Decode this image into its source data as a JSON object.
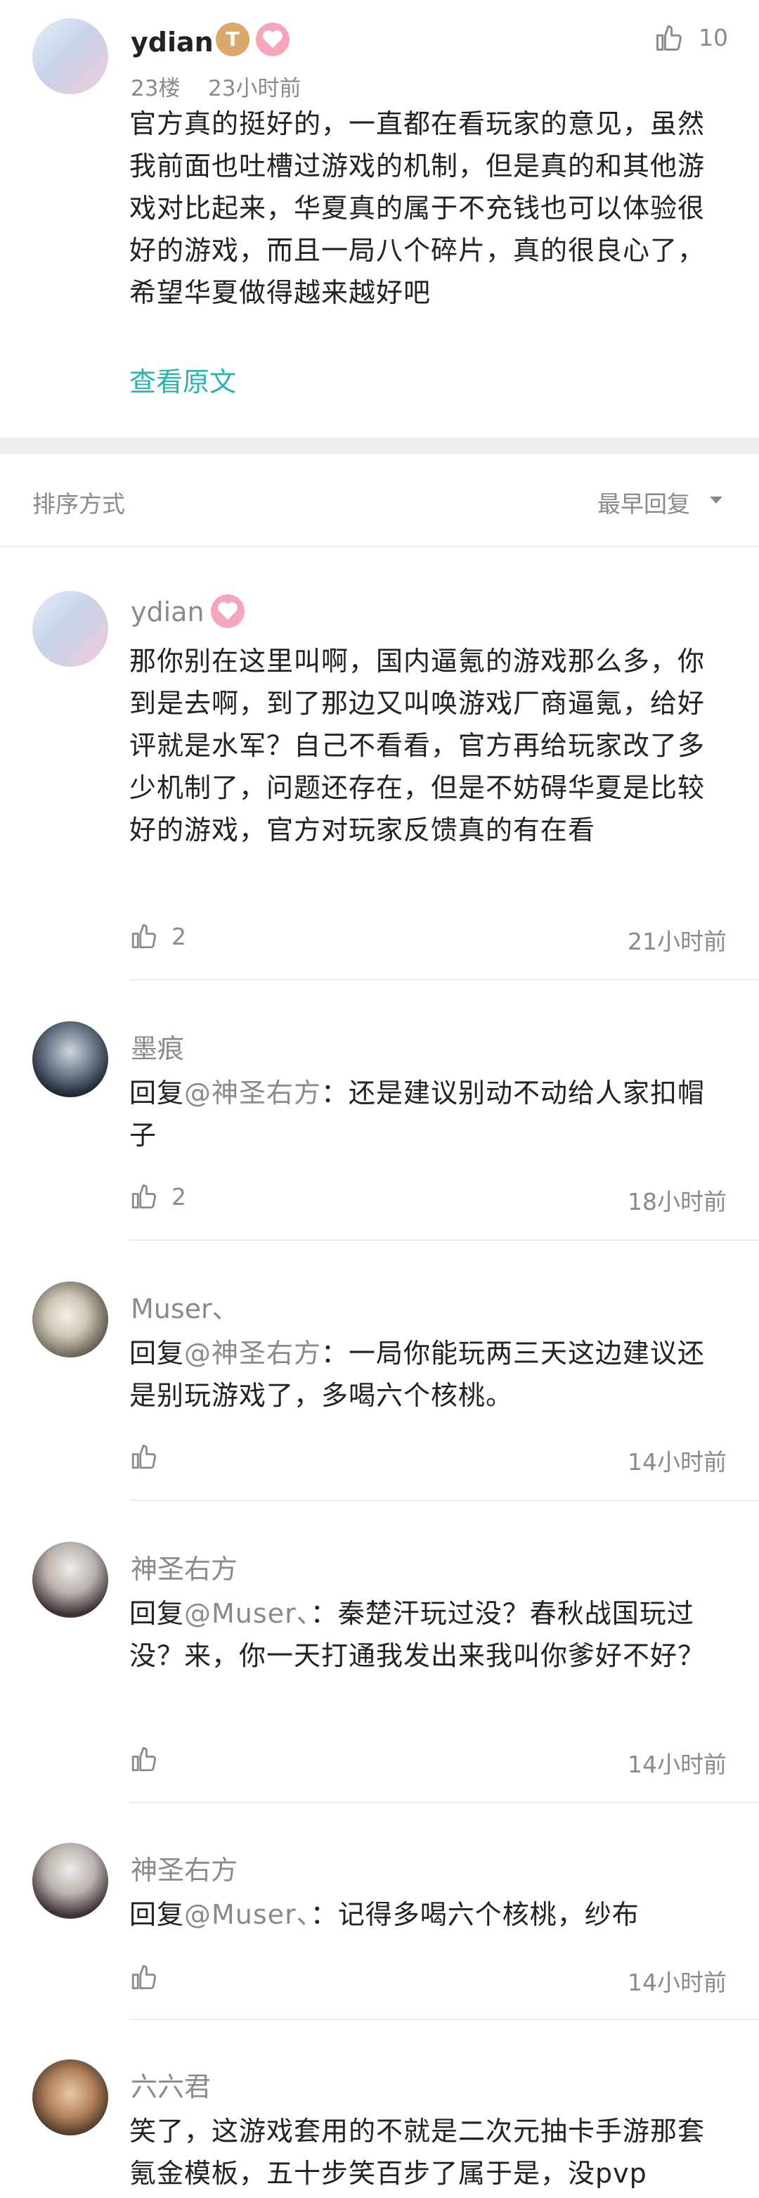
{
  "top_comment": {
    "username": "ydian",
    "level_badge": "T",
    "floor": "23楼",
    "time": "23小时前",
    "like_count": "10",
    "text": "官方真的挺好的，一直都在看玩家的意见，虽然我前面也吐槽过游戏的机制，但是真的和其他游戏对比起来，华夏真的属于不充钱也可以体验很好的游戏，而且一局八个碎片，真的很良心了，希望华夏做得越来越好吧",
    "view_original": "查看原文"
  },
  "sort_bar": {
    "label": "排序方式",
    "current": "最早回复"
  },
  "replies": [
    {
      "username": "ydian",
      "text": "那你别在这里叫啊，国内逼氪的游戏那么多，你到是去啊，到了那边又叫唤游戏厂商逼氪，给好评就是水军？自己不看看，官方再给玩家改了多少机制了，问题还存在，但是不妨碍华夏是比较好的游戏，官方对玩家反馈真的有在看",
      "likes": "2",
      "time": "21小时前"
    },
    {
      "username": "墨痕",
      "reply_prefix": "回复",
      "mention": "@神圣右方",
      "text": "：还是建议别动不动给人家扣帽子",
      "likes": "2",
      "time": "18小时前"
    },
    {
      "username": "Muser、",
      "reply_prefix": "回复",
      "mention": "@神圣右方",
      "text": "：一局你能玩两三天这边建议还是别玩游戏了，多喝六个核桃。",
      "likes": "",
      "time": "14小时前"
    },
    {
      "username": "神圣右方",
      "reply_prefix": "回复",
      "mention": "@Muser、",
      "text": "：秦楚汗玩过没？春秋战国玩过没？来，你一天打通我发出来我叫你爹好不好？",
      "likes": "",
      "time": "14小时前"
    },
    {
      "username": "神圣右方",
      "reply_prefix": "回复",
      "mention": "@Muser、",
      "text": "：记得多喝六个核桃，纱布",
      "likes": "",
      "time": "14小时前"
    },
    {
      "username": "六六君",
      "text": "笑了，这游戏套用的不就是二次元抽卡手游那套氪金模板，五十步笑百步了属于是，没pvp",
      "likes": "",
      "time": ""
    }
  ],
  "colors": {
    "link": "#2bb3ad",
    "muted": "#8a8a8a",
    "badge_gold": "#d9a86a",
    "badge_pink": "#f4a7b9"
  },
  "icons": [
    "like-thumb-icon",
    "dropdown-arrow-icon",
    "heart-badge-icon"
  ]
}
